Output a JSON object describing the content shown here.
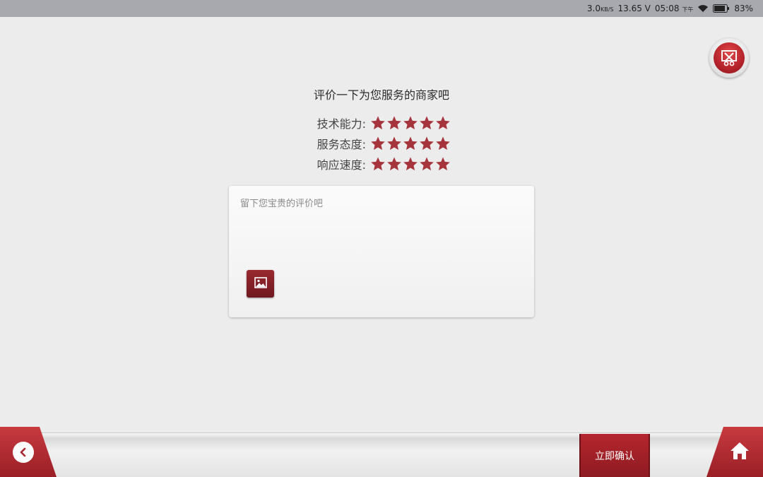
{
  "status_bar": {
    "net_speed": "3.0",
    "net_unit": "KB/S",
    "voltage": "13.65 V",
    "time": "05:08",
    "ampm": "下午",
    "battery": "83%"
  },
  "page": {
    "title": "评价一下为您服务的商家吧",
    "ratings": [
      {
        "label": "技术能力:",
        "stars": 5
      },
      {
        "label": "服务态度:",
        "stars": 5
      },
      {
        "label": "响应速度:",
        "stars": 5
      }
    ],
    "comment_placeholder": "留下您宝贵的评价吧"
  },
  "footer": {
    "confirm_label": "立即确认"
  },
  "colors": {
    "accent": "#a8262d",
    "star": "#a5343c"
  },
  "icons": {
    "exit": "exit-icon",
    "image": "image-icon",
    "back": "back-icon",
    "home": "home-icon"
  }
}
